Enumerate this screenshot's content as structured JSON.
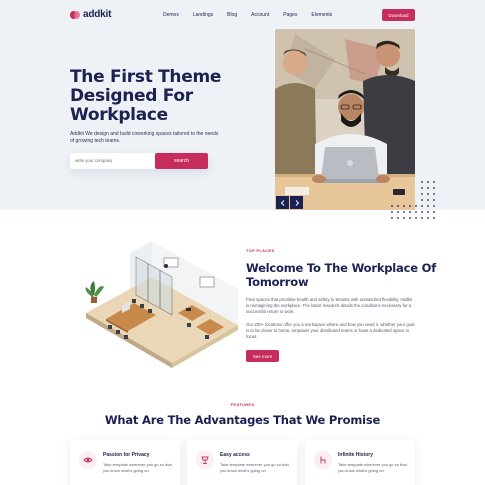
{
  "nav": {
    "logo_text": "addkit",
    "items": [
      "Demos",
      "Landings",
      "Blog",
      "Account",
      "Pages",
      "Elements"
    ],
    "cta_label": "Download"
  },
  "hero": {
    "title": "The First Theme Designed For Workplace",
    "description": "Addkit We design and build coworking spaces tailored to the needs of growing tech teams.",
    "input_placeholder": "write your company",
    "search_label": "search",
    "photo_icon": "team-laptop-photo",
    "prev_icon": "chevron-left-icon",
    "next_icon": "chevron-right-icon"
  },
  "welcome": {
    "eyebrow": "TOP PLACES",
    "title": "Welcome To The Workplace Of Tomorrow",
    "paragraph1": "Flexi spaces that prioritise health and safety to tenants with unmatched flexibility, Addkit is reimagining the workplace. The latest research details the conditions necessary for a successful return to work.",
    "paragraph2": "Our 200+ locations offer you a workspace where and how you need it, whether your goal is to be closer to home, empower your distributed teams or have a dedicated space to focus.",
    "button_label": "See more"
  },
  "advantages": {
    "eyebrow": "FEATURES",
    "title": "What Are The Advantages That We Promise",
    "cards": [
      {
        "title": "Passion for Privacy",
        "text": "Take template wherever you go so that you know what's going on",
        "icon": "eye-icon"
      },
      {
        "title": "Easy access",
        "text": "Take template wherever you go so that you know what's going on",
        "icon": "lamp-icon"
      },
      {
        "title": "Infinite History",
        "text": "Take template wherever you go so that you know what's going on",
        "icon": "chair-icon"
      }
    ]
  },
  "colors": {
    "accent": "#c72d5c",
    "navy": "#1b2150",
    "hero_bg": "#eef2f7"
  }
}
